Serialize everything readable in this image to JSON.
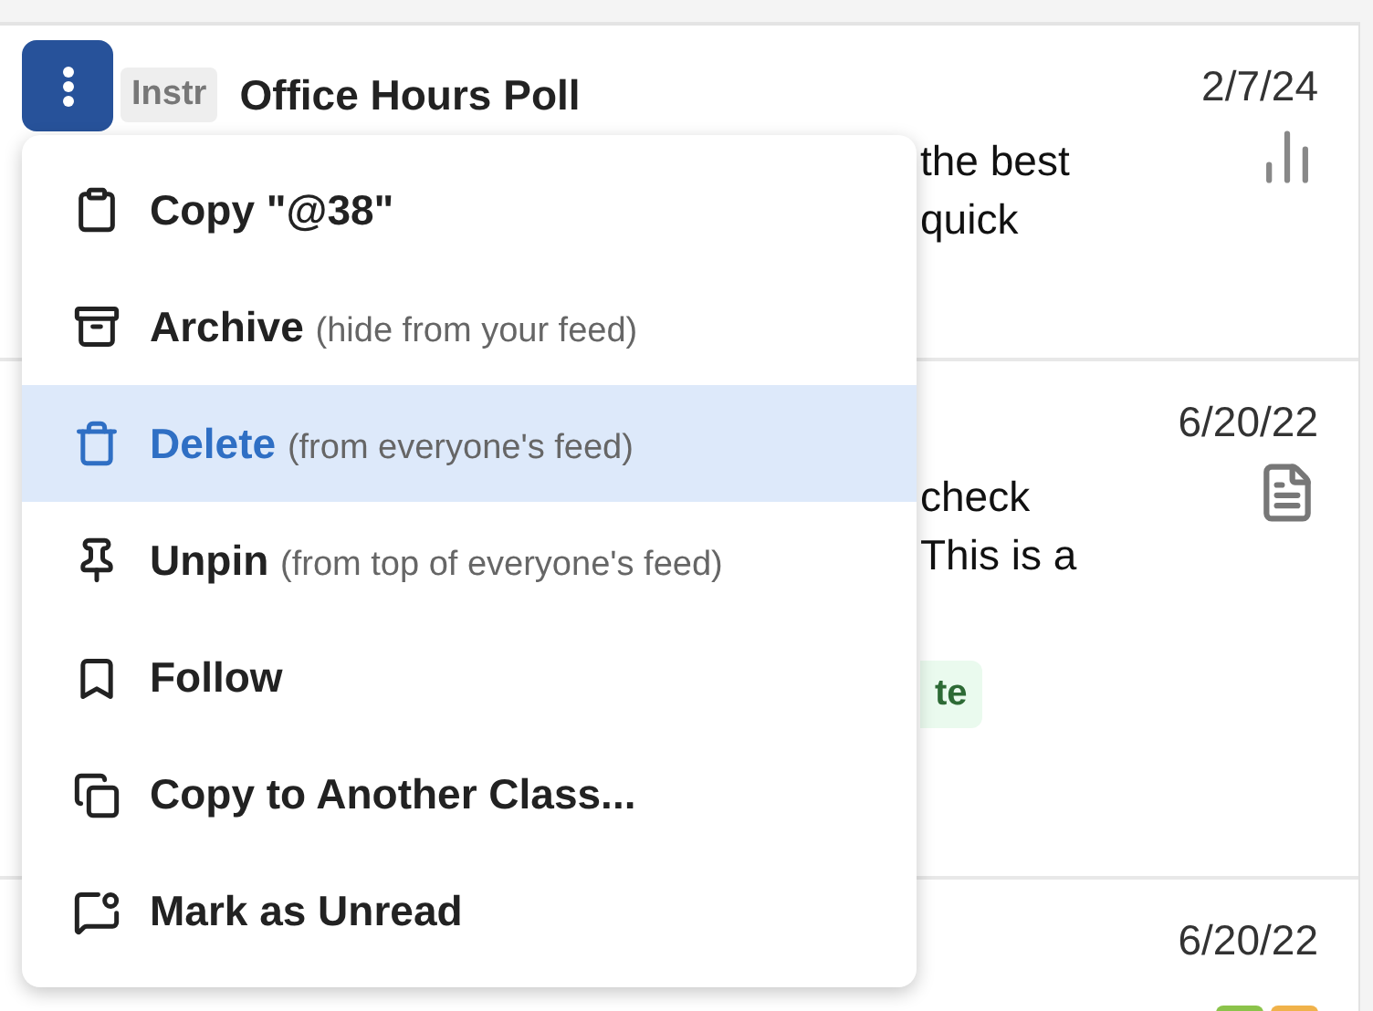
{
  "posts": [
    {
      "tag": "Instr",
      "title": "Office Hours Poll",
      "date": "2/7/24",
      "kind": "poll",
      "lines": [
        "the best",
        "quick"
      ]
    },
    {
      "date": "6/20/22",
      "kind": "note",
      "lines": [
        "check",
        "This is a"
      ],
      "badge": "te"
    },
    {
      "date": "6/20/22",
      "kind": "status"
    }
  ],
  "menu": {
    "items": [
      {
        "label": "Copy \"@38\"",
        "selected": false
      },
      {
        "label": "Archive",
        "note": "(hide from your feed)",
        "selected": false
      },
      {
        "label": "Delete",
        "note": "(from everyone's feed)",
        "selected": true
      },
      {
        "label": "Unpin",
        "note": "(from top of everyone's feed)",
        "selected": false
      },
      {
        "label": "Follow",
        "selected": false
      },
      {
        "label": "Copy to Another Class...",
        "selected": false
      },
      {
        "label": "Mark as Unread",
        "selected": false
      }
    ]
  }
}
